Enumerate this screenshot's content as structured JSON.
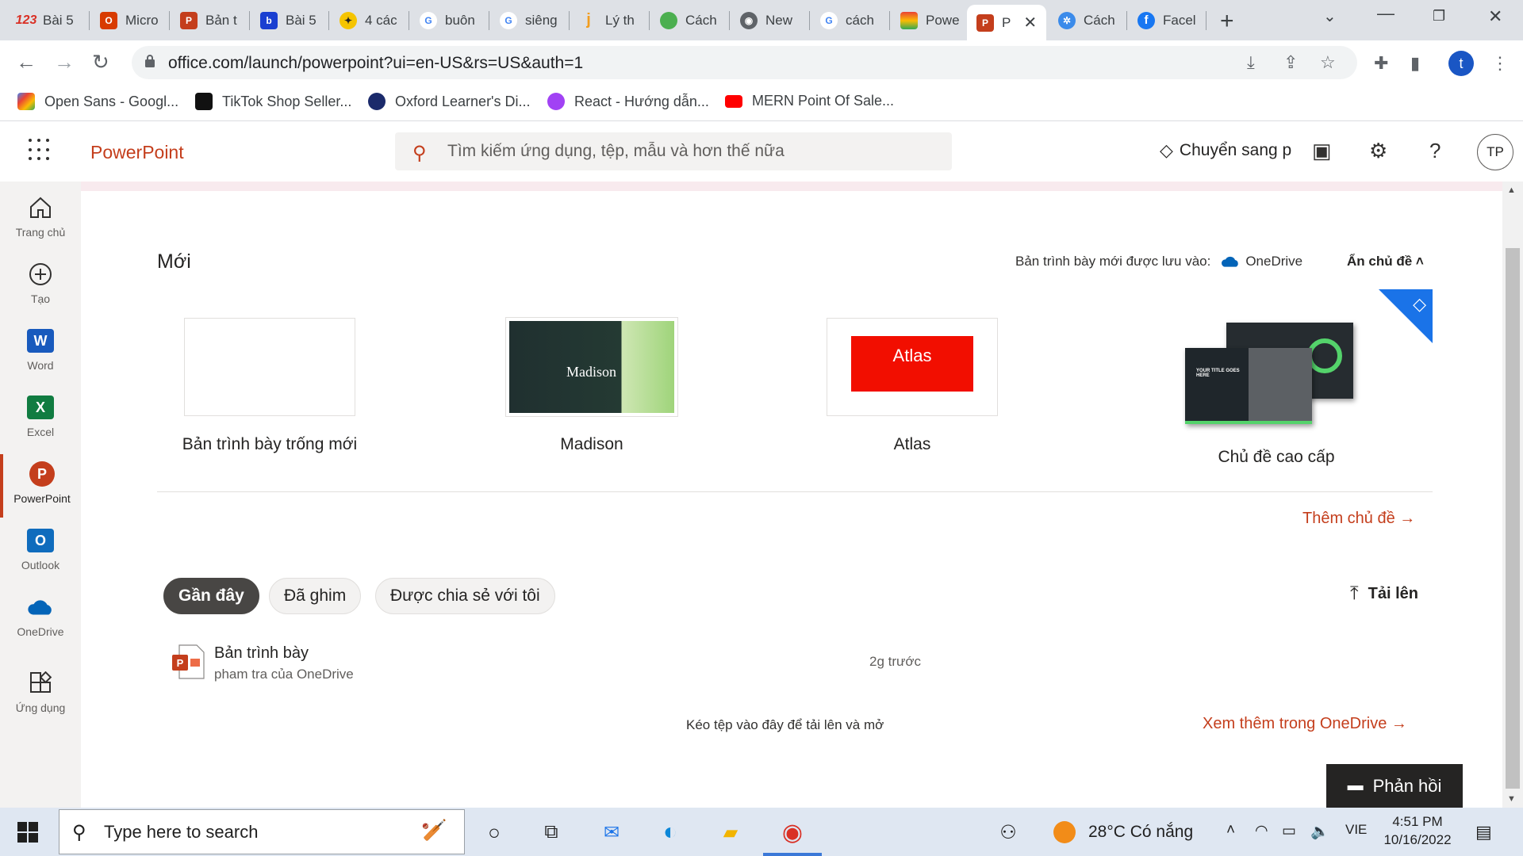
{
  "browser": {
    "tabs": [
      {
        "label": "Bài 5",
        "icon": "123-icon",
        "color": "#d93025"
      },
      {
        "label": "Micro",
        "icon": "office-icon",
        "color": "#d83b01"
      },
      {
        "label": "Bản t",
        "icon": "powerpoint-icon",
        "color": "#c43e1c"
      },
      {
        "label": "Bài 5",
        "icon": "bookmark-icon",
        "color": "#1a3fd1"
      },
      {
        "label": "4 các",
        "icon": "runner-icon",
        "color": "#f5c400"
      },
      {
        "label": "buôn",
        "icon": "google-icon",
        "color": "#4285f4"
      },
      {
        "label": "siêng",
        "icon": "google-icon",
        "color": "#4285f4"
      },
      {
        "label": "Lý th",
        "icon": "j-icon",
        "color": "#f29d1f"
      },
      {
        "label": "Cách",
        "icon": "leaf-icon",
        "color": "#4caf50"
      },
      {
        "label": "New",
        "icon": "chrome-icon",
        "color": "#5f6368"
      },
      {
        "label": "cách",
        "icon": "google-icon",
        "color": "#4285f4"
      },
      {
        "label": "Powe",
        "icon": "rainbow-icon",
        "color": "#e94235"
      },
      {
        "label": "P",
        "icon": "powerpoint-icon",
        "color": "#c43e1c",
        "active": true
      },
      {
        "label": "Cách",
        "icon": "compass-icon",
        "color": "#3b8bea"
      },
      {
        "label": "Facel",
        "icon": "facebook-icon",
        "color": "#1877f2"
      }
    ],
    "url": "office.com/launch/powerpoint?ui=en-US&rs=US&auth=1",
    "profile_initial": "t",
    "bookmarks": [
      {
        "label": "Open Sans - Googl...",
        "color": "#4285f4"
      },
      {
        "label": "TikTok Shop Seller...",
        "color": "#111111"
      },
      {
        "label": "Oxford Learner's Di...",
        "color": "#1b2a6b"
      },
      {
        "label": "React - Hướng dẫn...",
        "color": "#a142f4"
      },
      {
        "label": "MERN Point Of Sale...",
        "color": "#ff0000"
      }
    ]
  },
  "office": {
    "app_name": "PowerPoint",
    "search_placeholder": "Tìm kiếm ứng dụng, tệp, mẫu và hơn thế nữa",
    "premium_label": "Chuyển sang p",
    "user_initials": "TP",
    "accent": "#c43e1c",
    "rail": [
      {
        "label": "Trang chủ",
        "icon": "home-icon"
      },
      {
        "label": "Tạo",
        "icon": "plus-circle-icon"
      },
      {
        "label": "Word",
        "icon": "word-icon",
        "color": "#185abd"
      },
      {
        "label": "Excel",
        "icon": "excel-icon",
        "color": "#107c41"
      },
      {
        "label": "PowerPoint",
        "icon": "powerpoint-icon",
        "color": "#c43e1c",
        "active": true
      },
      {
        "label": "Outlook",
        "icon": "outlook-icon",
        "color": "#0f6cbd"
      },
      {
        "label": "OneDrive",
        "icon": "onedrive-icon",
        "color": "#0364b8"
      },
      {
        "label": "Ứng dụng",
        "icon": "apps-icon"
      }
    ]
  },
  "main": {
    "new_title": "Mới",
    "save_location_label": "Bản trình bày mới được lưu vào:",
    "save_location_target": "OneDrive",
    "hide_themes": "Ẩn chủ đề ˄",
    "templates": [
      {
        "label": "Bản trình bày trống mới",
        "thumb_text": ""
      },
      {
        "label": "Madison",
        "thumb_text": "Madison"
      },
      {
        "label": "Atlas",
        "thumb_text": "Atlas"
      },
      {
        "label": "Chủ đề cao cấp",
        "thumb_text": "YOUR TITLE GOES HERE"
      }
    ],
    "more_themes": "Thêm chủ đề →",
    "tabs": [
      "Gần đây",
      "Đã ghim",
      "Được chia sẻ với tôi"
    ],
    "upload": "Tải lên",
    "files": [
      {
        "name": "Bản trình bày",
        "location": "pham tra của OneDrive",
        "modified": "2g trước"
      }
    ],
    "drag_hint": "Kéo tệp vào đây để tải lên và mở",
    "see_more": "Xem thêm trong OneDrive →",
    "feedback": "Phản hồi"
  },
  "taskbar": {
    "search_placeholder": "Type here to search",
    "weather": "28°C  Có nắng",
    "lang": "VIE",
    "time": "4:51 PM",
    "date": "10/16/2022"
  }
}
